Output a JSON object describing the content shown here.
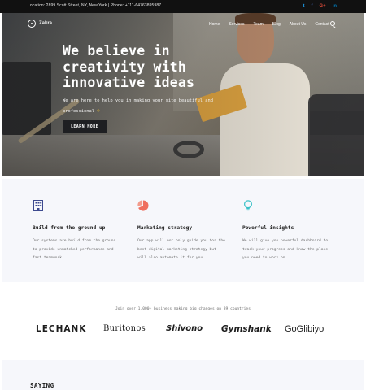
{
  "topbar": {
    "address": "Location: 2899 Scott Street, NY, New York | Phone: +111-64763895987",
    "socials": [
      {
        "icon": "twitter-icon",
        "glyph": "t",
        "color": "#1da1f2"
      },
      {
        "icon": "facebook-icon",
        "glyph": "f",
        "color": "#3b5998"
      },
      {
        "icon": "google-plus-icon",
        "glyph": "G+",
        "color": "#dd4b39"
      },
      {
        "icon": "linkedin-icon",
        "glyph": "in",
        "color": "#0077b5"
      }
    ]
  },
  "header": {
    "brand": "Zakra",
    "nav": [
      "Home",
      "Services",
      "Team",
      "Blog",
      "About Us",
      "Contact"
    ],
    "active_nav": "Home"
  },
  "hero": {
    "title": "We believe in creativity with innovative ideas",
    "subtitle": "We are here to help you in making your site beautiful and professional",
    "emoji": "☺",
    "cta": "LEARN MORE"
  },
  "features": [
    {
      "icon": "building-icon",
      "color": "#3d4a8f",
      "title": "Build from the ground up",
      "text": "Our systems are build from the ground to provide unmatched performance and fast teamwork"
    },
    {
      "icon": "pie-chart-icon",
      "color": "#ef6e5d",
      "title": "Marketing strategy",
      "text": "Our app will not only guide you for the best digital marketing strategy but will also automate it for you"
    },
    {
      "icon": "lightbulb-icon",
      "color": "#38c1c7",
      "title": "Powerful insights",
      "text": "We will give you powerful dashboard to track your progress and know the place you need to work on"
    }
  ],
  "clients": {
    "note": "Join over 1,000+ business making big changes on 89 countries",
    "logos": [
      "LECHANK",
      "Buritonos",
      "Shivono",
      "Gymshank",
      "GoGlibiyo"
    ]
  },
  "saying": {
    "title": "SAYING"
  }
}
